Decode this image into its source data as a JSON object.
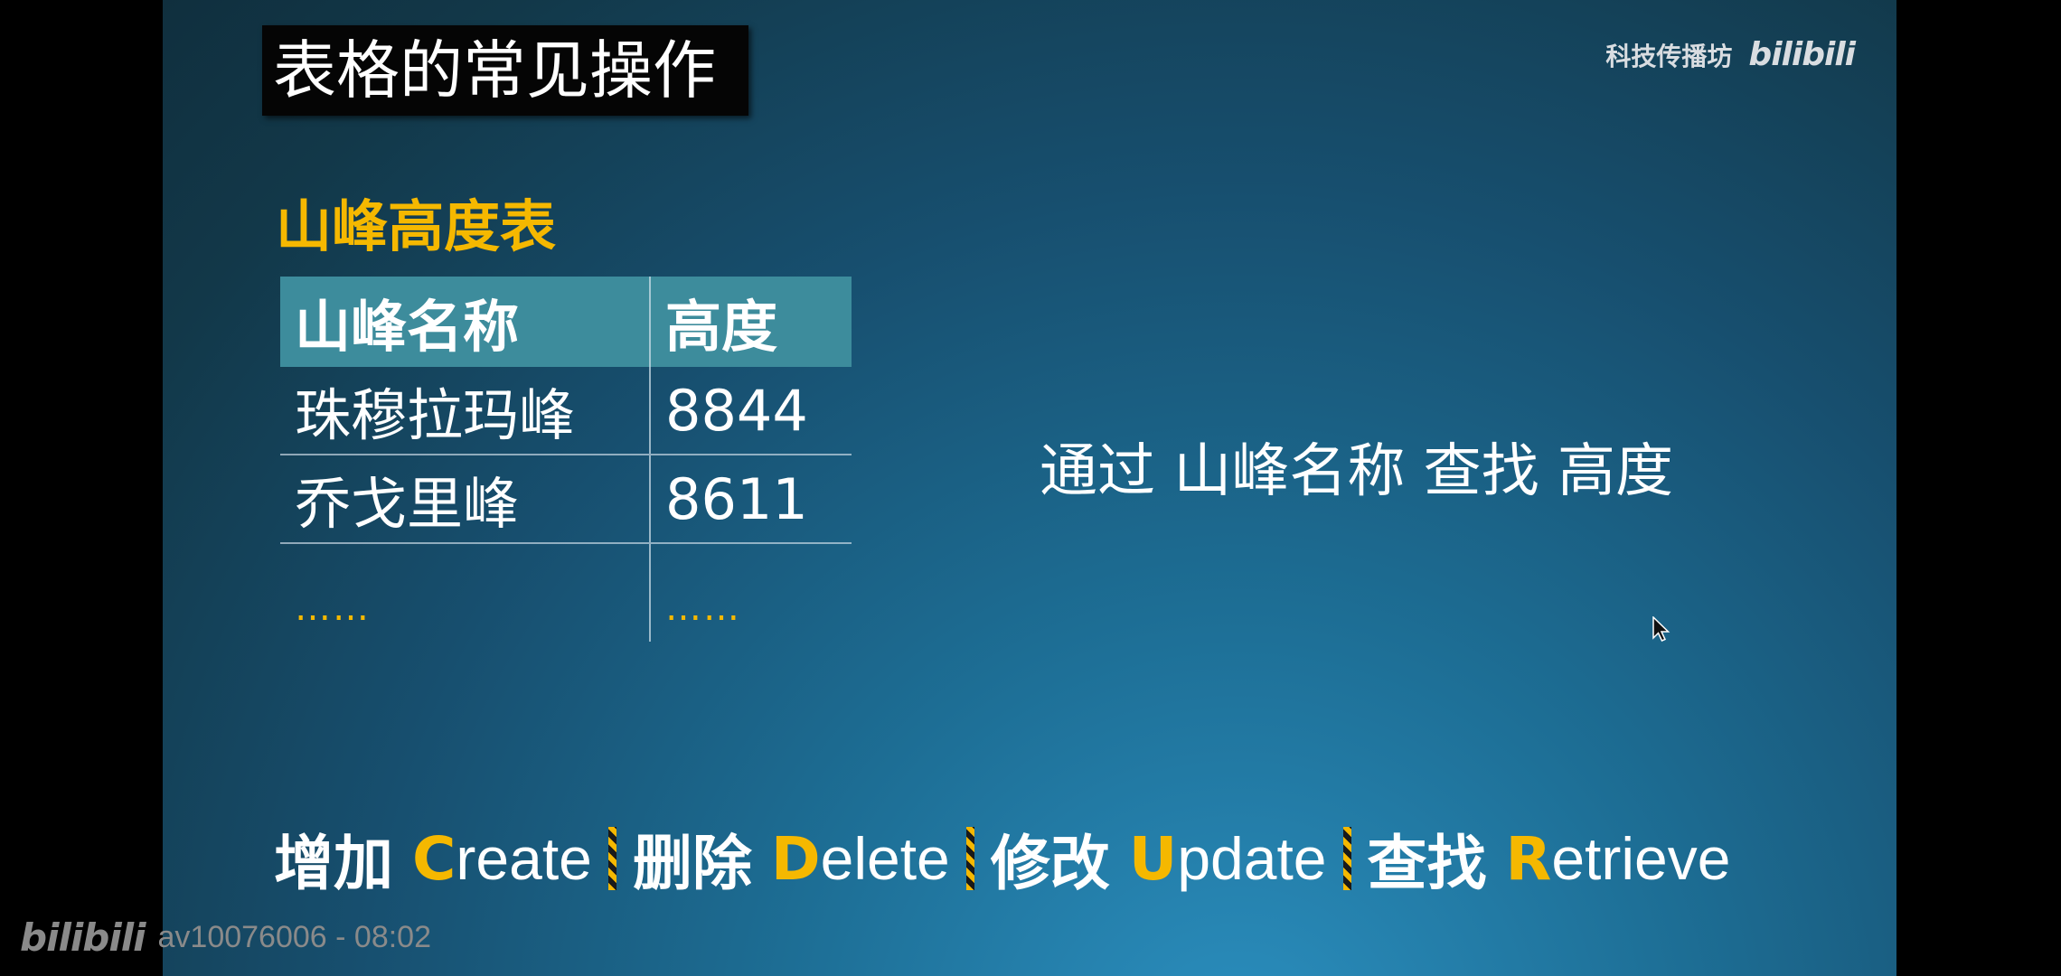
{
  "slide": {
    "title": "表格的常见操作",
    "watermark_text": "科技传播坊",
    "watermark_logo": "bilibili",
    "subtitle": "山峰高度表",
    "table": {
      "headers": [
        "山峰名称",
        "高度"
      ],
      "rows": [
        [
          "珠穆拉玛峰",
          "8844"
        ],
        [
          "乔戈里峰",
          "8611"
        ],
        [
          "……",
          "……"
        ]
      ]
    },
    "query_text": "通过 山峰名称 查找 高度",
    "crud": [
      {
        "zh": "增加",
        "letter": "C",
        "rest": "reate"
      },
      {
        "zh": "删除",
        "letter": "D",
        "rest": "elete"
      },
      {
        "zh": "修改",
        "letter": "U",
        "rest": "pdate"
      },
      {
        "zh": "查找",
        "letter": "R",
        "rest": "etrieve"
      }
    ]
  },
  "player": {
    "logo": "bilibili",
    "video_info": "av10076006 - 08:02"
  },
  "colors": {
    "accent": "#f5b800",
    "header_bg": "#3d8c9c",
    "title_bg": "#050505"
  }
}
